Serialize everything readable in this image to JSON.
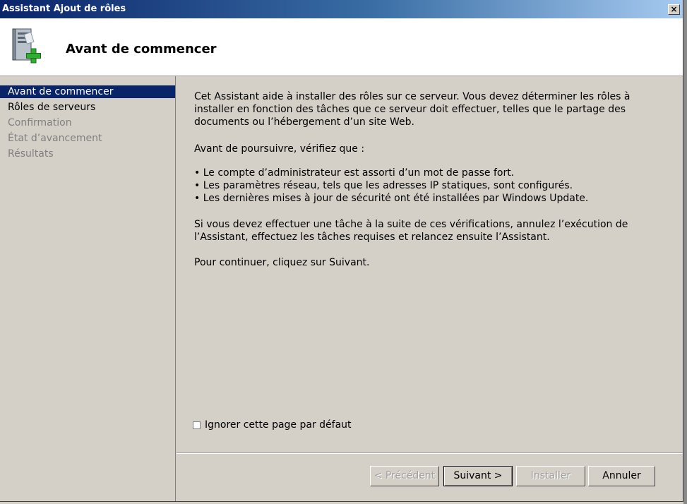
{
  "window": {
    "title": "Assistant Ajout de rôles",
    "close_glyph": "×"
  },
  "header": {
    "page_title": "Avant de commencer",
    "icon": "server-add-icon"
  },
  "sidebar": {
    "items": [
      {
        "label": "Avant de commencer",
        "state": "active"
      },
      {
        "label": "Rôles de serveurs",
        "state": "enabled"
      },
      {
        "label": "Confirmation",
        "state": "disabled"
      },
      {
        "label": "État d’avancement",
        "state": "disabled"
      },
      {
        "label": "Résultats",
        "state": "disabled"
      }
    ]
  },
  "content": {
    "intro": "Cet Assistant aide à installer des rôles sur ce serveur. Vous devez déterminer les rôles à installer en fonction des tâches que ce serveur doit effectuer, telles que le partage des documents ou l’hébergement d’un site Web.",
    "verify_heading": "Avant de poursuivre, vérifiez que :",
    "checks": [
      "• Le compte d’administrateur est assorti d’un mot de passe fort.",
      "• Les paramètres réseau, tels que les adresses IP statiques, sont configurés.",
      "• Les dernières mises à jour de sécurité ont été installées par Windows Update."
    ],
    "cancel_note": "Si vous devez effectuer une tâche à la suite de ces vérifications, annulez l’exécution de l’Assistant, effectuez les tâches requises et relancez ensuite l’Assistant.",
    "continue_note": "Pour continuer, cliquez sur Suivant.",
    "skip_checkbox_label": "Ignorer cette page par défaut",
    "skip_checked": false
  },
  "buttons": {
    "previous": "< Précédent",
    "next": "Suivant >",
    "install": "Installer",
    "cancel": "Annuler"
  },
  "colors": {
    "accent": "#0a246a",
    "face": "#d4d0c8"
  }
}
